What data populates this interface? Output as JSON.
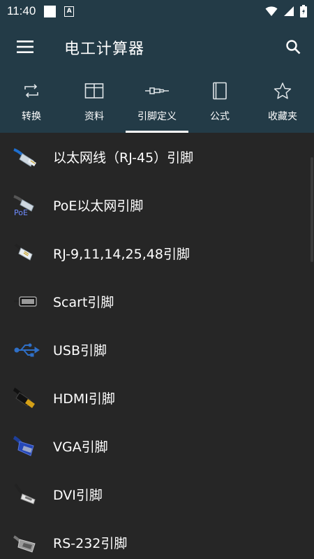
{
  "status_bar": {
    "time": "11:40",
    "notif_letter": "A"
  },
  "app": {
    "title": "电工计算器"
  },
  "tabs": [
    {
      "label": "转换",
      "icon": "convert-icon",
      "active": false
    },
    {
      "label": "资料",
      "icon": "table-icon",
      "active": false
    },
    {
      "label": "引脚定义",
      "icon": "connector-icon",
      "active": true
    },
    {
      "label": "公式",
      "icon": "book-icon",
      "active": false
    },
    {
      "label": "收藏夹",
      "icon": "star-icon",
      "active": false
    }
  ],
  "items": [
    {
      "label": "以太网线（RJ-45）引脚",
      "icon": "ethernet-cable-icon"
    },
    {
      "label": "PoE以太网引脚",
      "icon": "poe-cable-icon"
    },
    {
      "label": "RJ-9,11,14,25,48引脚",
      "icon": "rj-phone-plug-icon"
    },
    {
      "label": "Scart引脚",
      "icon": "scart-plug-icon"
    },
    {
      "label": "USB引脚",
      "icon": "usb-icon"
    },
    {
      "label": "HDMI引脚",
      "icon": "hdmi-plug-icon"
    },
    {
      "label": "VGA引脚",
      "icon": "vga-plug-icon"
    },
    {
      "label": "DVI引脚",
      "icon": "dvi-plug-icon"
    },
    {
      "label": "RS-232引脚",
      "icon": "rs232-plug-icon"
    }
  ],
  "colors": {
    "header": "#233b47",
    "background": "#262626",
    "text": "#ffffff"
  }
}
